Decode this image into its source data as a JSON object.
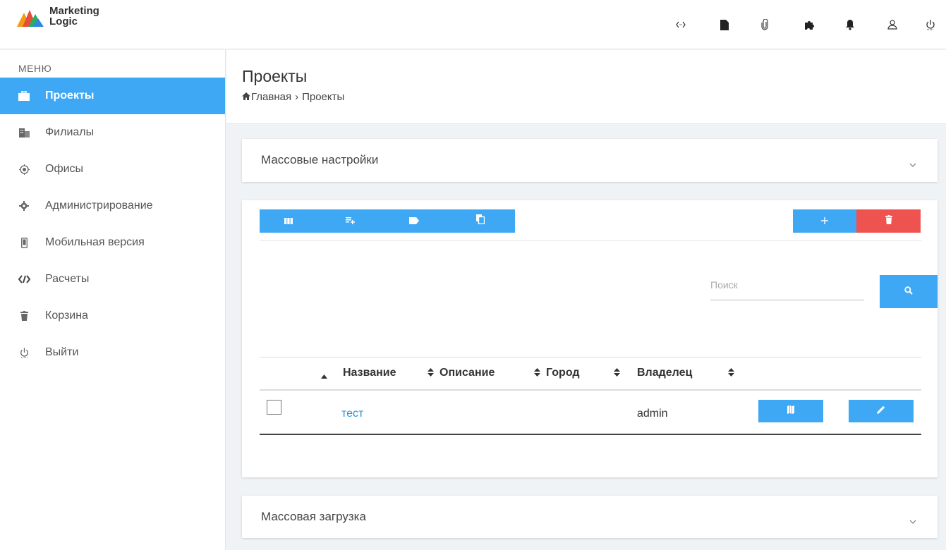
{
  "app": {
    "logo_line1": "Marketing",
    "logo_line2": "Logic"
  },
  "topbar_icons": [
    "code-icon",
    "file-icon",
    "paperclip-icon",
    "puzzle-icon",
    "bell-icon",
    "user-icon",
    "power-icon"
  ],
  "sidebar": {
    "menu_label": "МЕНЮ",
    "items": [
      {
        "label": "Проекты",
        "icon": "briefcase-icon",
        "active": true
      },
      {
        "label": "Филиалы",
        "icon": "building-icon"
      },
      {
        "label": "Офисы",
        "icon": "target-icon"
      },
      {
        "label": "Администрирование",
        "icon": "gear-icon"
      },
      {
        "label": "Мобильная версия",
        "icon": "mobile-icon"
      },
      {
        "label": "Расчеты",
        "icon": "calc-icon"
      },
      {
        "label": "Корзина",
        "icon": "trash-icon"
      },
      {
        "label": "Выйти",
        "icon": "power-icon"
      }
    ]
  },
  "page": {
    "title": "Проекты",
    "breadcrumb": {
      "home": "Главная",
      "current": "Проекты"
    }
  },
  "mass_settings": {
    "title": "Массовые настройки"
  },
  "toolbar": {
    "left_icons": [
      "columns-icon",
      "add-list-icon",
      "tag-icon",
      "copy-icon"
    ],
    "add_icon": "plus-icon",
    "delete_icon": "trash-icon"
  },
  "search": {
    "placeholder": "Поиск",
    "value": ""
  },
  "table": {
    "columns": [
      "Название",
      "Описание",
      "Город",
      "Владелец"
    ],
    "rows": [
      {
        "name": "тест",
        "description": "",
        "city": "",
        "owner": "admin"
      }
    ]
  },
  "mass_upload": {
    "title": "Массовая загрузка"
  },
  "colors": {
    "accent": "#3fa8f4",
    "danger": "#ef5350",
    "link": "#2e8fd6"
  }
}
